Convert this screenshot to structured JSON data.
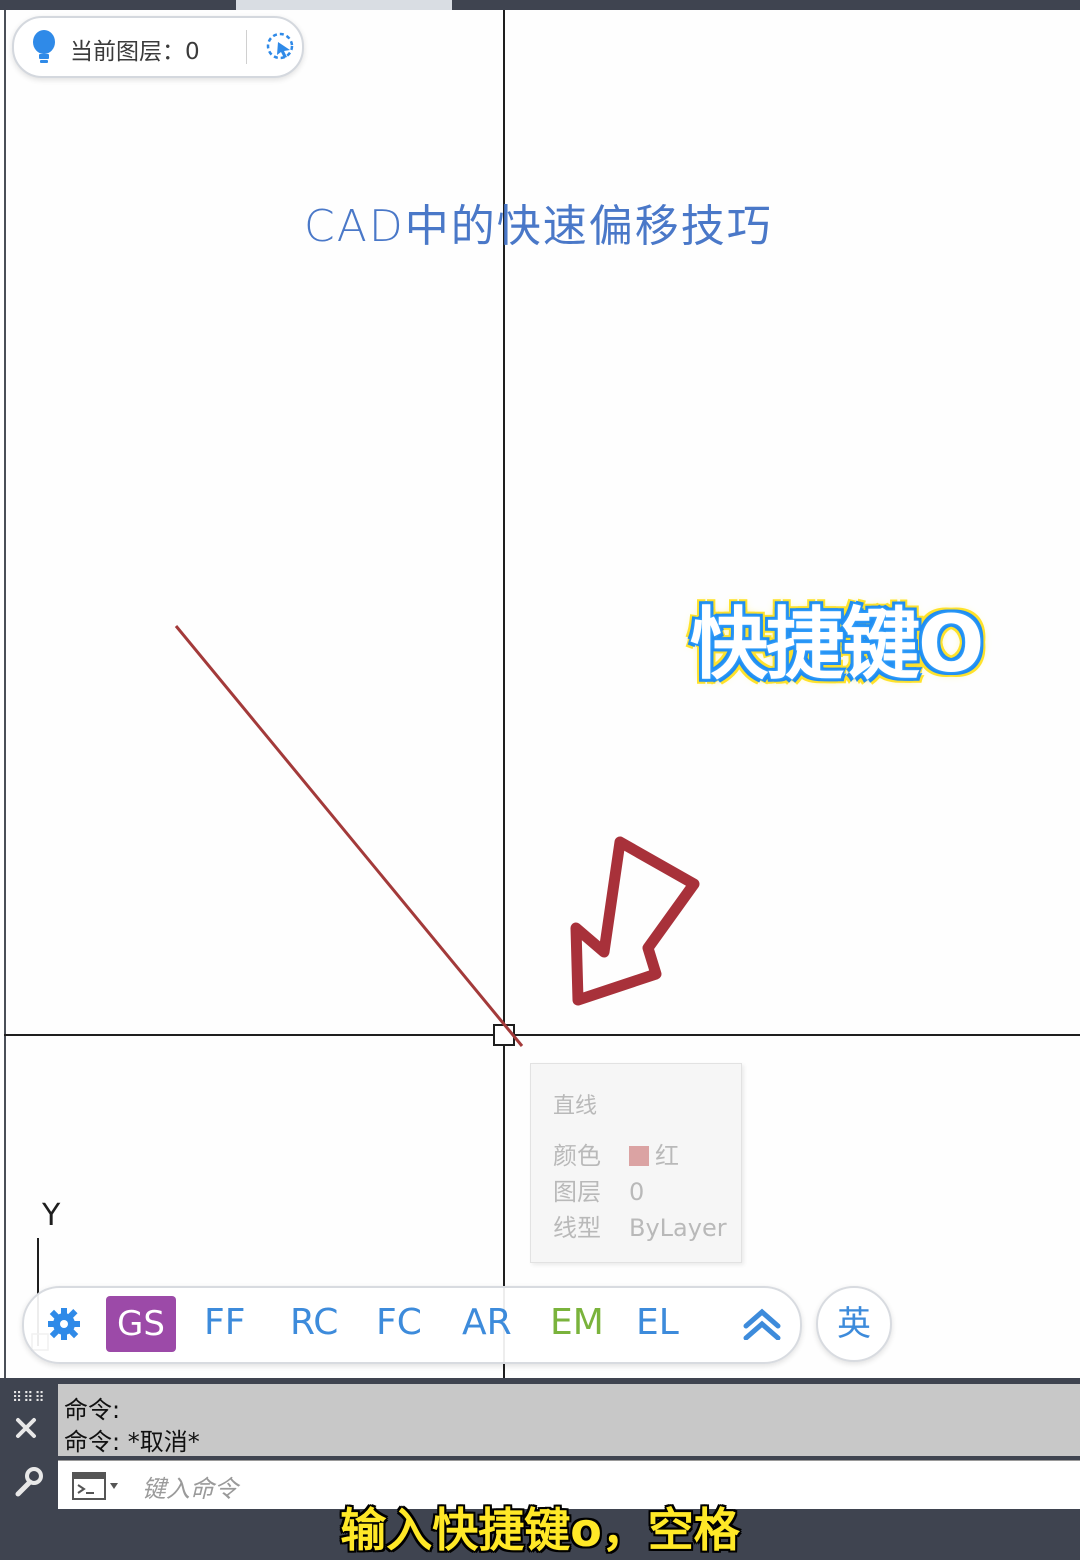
{
  "layer_indicator": {
    "label": "当前图层：0"
  },
  "drawing": {
    "title_text": "CAD中的快速偏移技巧"
  },
  "overlay": {
    "shortcut_caption": "快捷键O"
  },
  "tooltip": {
    "title": "直线",
    "rows": [
      {
        "key": "颜色",
        "value": "红"
      },
      {
        "key": "图层",
        "value": "0"
      },
      {
        "key": "线型",
        "value": "ByLayer"
      }
    ]
  },
  "ucs": {
    "y_label": "Y"
  },
  "quickbar": {
    "buttons": [
      {
        "label": "GS",
        "color": "#ffffff"
      },
      {
        "label": "FF",
        "color": "#3d8bdb"
      },
      {
        "label": "RC",
        "color": "#3d8bdb"
      },
      {
        "label": "FC",
        "color": "#3d8bdb"
      },
      {
        "label": "AR",
        "color": "#3d8bdb"
      },
      {
        "label": "EM",
        "color": "#7ab33c"
      },
      {
        "label": "EL",
        "color": "#3d8bdb"
      }
    ],
    "lang_label": "英"
  },
  "command": {
    "history": [
      "命令:",
      "命令:  *取消*"
    ],
    "input_placeholder": "键入命令"
  },
  "subtitle": "输入快捷键o，空格",
  "colors": {
    "accent": "#3d8bdb",
    "gs_button": "#9c4aa8",
    "line_red": "#a33a3a",
    "arrow_red": "#a8313a"
  }
}
